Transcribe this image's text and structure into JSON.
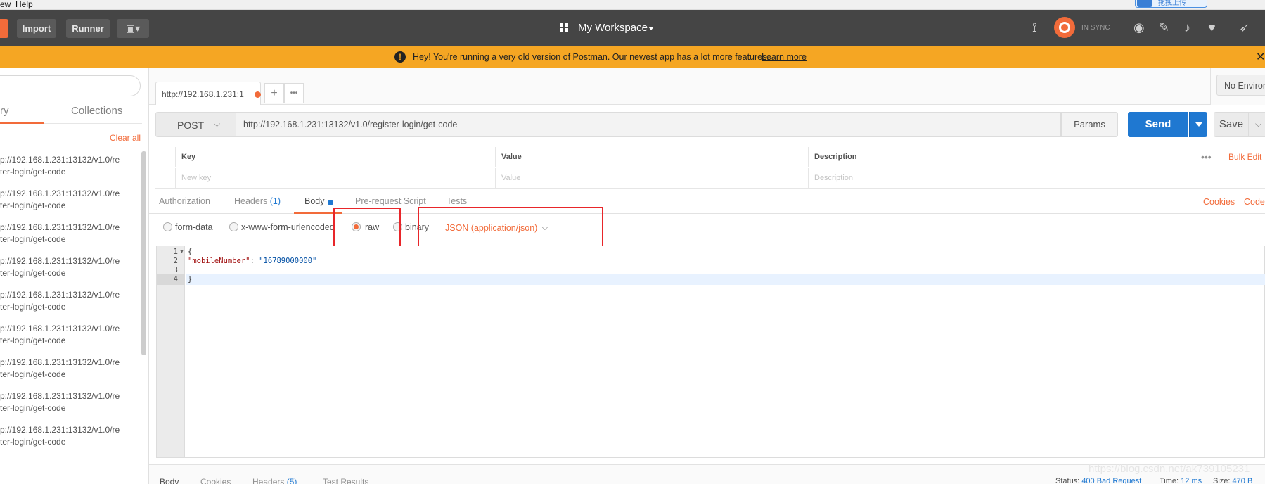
{
  "menubar": {
    "view": "ew",
    "help": "Help",
    "sync_widget_text": "拖拽上传"
  },
  "header": {
    "import_label": "Import",
    "runner_label": "Runner",
    "workspace_label": "My Workspace",
    "sync_status": "IN SYNC"
  },
  "banner": {
    "message": "Hey! You're running a very old version of Postman. Our newest app has a lot more features.",
    "link": "Learn more"
  },
  "sidebar": {
    "tab_history": "ry",
    "tab_collections": "Collections",
    "clear_all": "Clear all",
    "items": [
      {
        "line1": "p://192.168.1.231:13132/v1.0/re",
        "line2": "ter-login/get-code"
      },
      {
        "line1": "p://192.168.1.231:13132/v1.0/re",
        "line2": "ter-login/get-code"
      },
      {
        "line1": "p://192.168.1.231:13132/v1.0/re",
        "line2": "ter-login/get-code"
      },
      {
        "line1": "p://192.168.1.231:13132/v1.0/re",
        "line2": "ter-login/get-code"
      },
      {
        "line1": "p://192.168.1.231:13132/v1.0/re",
        "line2": "ter-login/get-code"
      },
      {
        "line1": "p://192.168.1.231:13132/v1.0/re",
        "line2": "ter-login/get-code"
      },
      {
        "line1": "p://192.168.1.231:13132/v1.0/re",
        "line2": "ter-login/get-code"
      },
      {
        "line1": "p://192.168.1.231:13132/v1.0/re",
        "line2": "ter-login/get-code"
      },
      {
        "line1": "p://192.168.1.231:13132/v1.0/re",
        "line2": "ter-login/get-code"
      }
    ]
  },
  "tabs": {
    "active_tab": "http://192.168.1.231:1",
    "add_label": "+",
    "more_label": "•••"
  },
  "environment": {
    "selected": "No Environment"
  },
  "request": {
    "method": "POST",
    "url": "http://192.168.1.231:13132/v1.0/register-login/get-code",
    "params_label": "Params",
    "send_label": "Send",
    "save_label": "Save"
  },
  "params_table": {
    "headers": [
      "Key",
      "Value",
      "Description"
    ],
    "placeholders": [
      "New key",
      "Value",
      "Description"
    ],
    "bulk_edit": "Bulk Edit",
    "more": "•••"
  },
  "subtabs": {
    "authorization": "Authorization",
    "headers": "Headers",
    "headers_count": "(1)",
    "body": "Body",
    "prerequest": "Pre-request Script",
    "tests": "Tests",
    "cookies": "Cookies",
    "code": "Code"
  },
  "body_options": {
    "form_data": "form-data",
    "urlencoded": "x-www-form-urlencoded",
    "raw": "raw",
    "binary": "binary",
    "selected": "raw",
    "content_type": "JSON (application/json)"
  },
  "editor": {
    "lines": [
      {
        "num": "1",
        "text": "{"
      },
      {
        "num": "2",
        "key": "\"mobileNumber\"",
        "sep": ": ",
        "value": "\"16789000000\""
      },
      {
        "num": "3",
        "text": ""
      },
      {
        "num": "4",
        "text": "}"
      }
    ]
  },
  "response": {
    "tab_body": "Body",
    "tab_cookies": "Cookies",
    "tab_headers": "Headers",
    "headers_count": "(5)",
    "tab_tests": "Test Results",
    "status_label": "Status:",
    "status_value": "400 Bad Request",
    "time_label": "Time:",
    "time_value": "12 ms",
    "size_label": "Size:",
    "size_value": "470 B"
  },
  "watermark": "https://blog.csdn.net/ak739105231",
  "colors": {
    "accent": "#f26b3a",
    "send": "#1f78d1",
    "banner": "#f5a623",
    "header": "#454545"
  }
}
